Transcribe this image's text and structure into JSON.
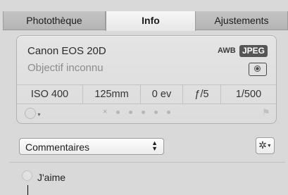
{
  "tabs": [
    {
      "label": "Photothèque",
      "active": false
    },
    {
      "label": "Info",
      "active": true
    },
    {
      "label": "Ajustements",
      "active": false
    }
  ],
  "info": {
    "camera": "Canon EOS 20D",
    "lens": "Objectif inconnu",
    "awb": "AWB",
    "format": "JPEG",
    "exif": [
      "ISO 400",
      "125mm",
      "0 ev",
      "ƒ/5",
      "1/500"
    ],
    "reject_mark": "×",
    "rating_stars": 0,
    "rating_max": 5
  },
  "metadata_view": {
    "selected": "Commentaires"
  },
  "comments": {
    "like_label": "J'aime"
  }
}
